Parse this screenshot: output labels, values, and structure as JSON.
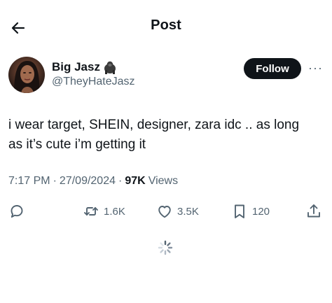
{
  "header": {
    "title": "Post",
    "back_icon": "arrow-left-icon"
  },
  "author": {
    "name": "Big Jasz",
    "name_emoji": "gorilla-emoji",
    "handle": "@TheyHateJasz",
    "avatar_icon": "profile-photo"
  },
  "follow_label": "Follow",
  "more_label": "···",
  "tweet": {
    "line1": "i wear target, SHEIN, designer, zara idc .. as long",
    "line2": "as it’s cute i’m getting it"
  },
  "meta": {
    "time": "7:17 PM",
    "date": "27/09/2024",
    "sep": "·",
    "views_count": "97K",
    "views_label": "Views"
  },
  "actions": {
    "reply_icon": "reply-icon",
    "retweet_icon": "retweet-icon",
    "retweets": "1.6K",
    "like_icon": "heart-icon",
    "likes": "3.5K",
    "bookmark_icon": "bookmark-icon",
    "bookmarks": "120",
    "share_icon": "share-icon"
  },
  "loading_icon": "loading-spinner-icon",
  "colors": {
    "text": "#0f1419",
    "secondary": "#536471",
    "button": "#0f1419"
  }
}
